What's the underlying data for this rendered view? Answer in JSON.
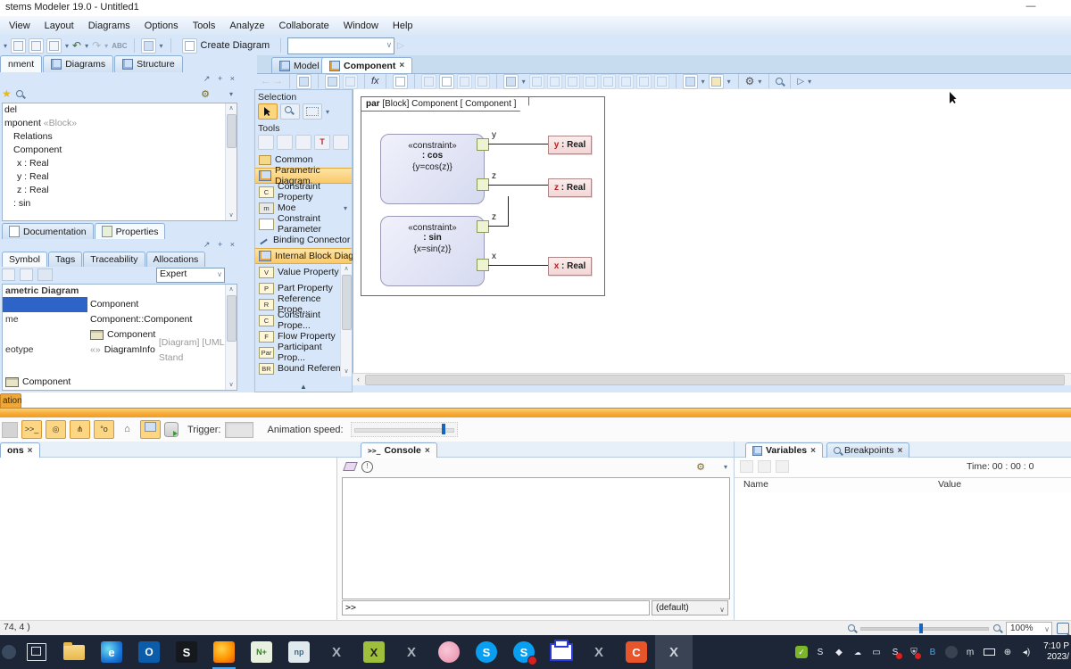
{
  "icons": {
    "minimize": "—",
    "close": "×",
    "dropdown": "▾",
    "chevron": "∨",
    "scroll_up": "∧",
    "scroll_down": "∨",
    "scroll_left": "‹",
    "palette_up": "▲",
    "float": "↗",
    "pin": "+",
    "gear": "⚙",
    "star": "★",
    "play": "▷",
    "fx": "fx",
    "abc": "ABC",
    "undo": "↶",
    "redo": "↷",
    "back": "←",
    "forward": "→",
    "console_glyph": ">>_",
    "target_glyph": "◎",
    "tree_glyph": "⋔",
    "nodes_glyph": "°o",
    "bang": "!",
    "x_letter": "X",
    "s_letter": "S",
    "o_letter": "O",
    "c_letter": "C",
    "e_letter": "e",
    "n_letters": "N+",
    "np_letters": "np",
    "diamond": "◆",
    "bt_letter": "B",
    "mic_glyph": "ṃ",
    "globe_glyph": "⊕",
    "spk_glyph": "◂)",
    "bubble_glyph": "▭",
    "check": "✓"
  },
  "title_bar": {
    "title": "stems Modeler 19.0 - Untitled1"
  },
  "menu": {
    "items": [
      {
        "label": "View"
      },
      {
        "label": "Layout"
      },
      {
        "label": "Diagrams"
      },
      {
        "label": "Options"
      },
      {
        "label": "Tools"
      },
      {
        "label": "Analyze"
      },
      {
        "label": "Collaborate"
      },
      {
        "label": "Window"
      },
      {
        "label": "Help"
      }
    ]
  },
  "main_toolbar": {
    "create_diagram": "Create Diagram"
  },
  "left_tabs": {
    "items": [
      {
        "label": "nment"
      },
      {
        "label": "Diagrams"
      },
      {
        "label": "Structure"
      }
    ]
  },
  "diagram_tabs": {
    "model": "Model",
    "component": "Component"
  },
  "containment": {
    "items": [
      {
        "label": "del",
        "stereotype": ""
      },
      {
        "label": "mponent ",
        "stereotype": "«Block»"
      },
      {
        "label": "Relations",
        "stereotype": ""
      },
      {
        "label": "Component",
        "stereotype": ""
      },
      {
        "label": "x : Real",
        "stereotype": ""
      },
      {
        "label": "y : Real",
        "stereotype": ""
      },
      {
        "label": "z : Real",
        "stereotype": ""
      },
      {
        "label": ": sin",
        "stereotype": ""
      }
    ]
  },
  "doc_tabs": {
    "documentation": "Documentation",
    "properties": "Properties"
  },
  "properties_panel": {
    "tabs": [
      {
        "label": "Symbol"
      },
      {
        "label": "Tags"
      },
      {
        "label": "Traceability"
      },
      {
        "label": "Allocations"
      }
    ],
    "mode": "Expert",
    "category": "ametric Diagram",
    "rows": [
      {
        "label": "",
        "value": "Component"
      },
      {
        "label": "me",
        "value": "Component::Component"
      },
      {
        "label": "",
        "value": "Component"
      },
      {
        "label": "eotype",
        "value_prefix": "«»",
        "value": "DiagramInfo",
        "value_suffix": "[Diagram] [UML Stand"
      }
    ],
    "footer_value": "Component"
  },
  "palette": {
    "selection_label": "Selection",
    "tools_label": "Tools",
    "tools_t": "T",
    "groups": [
      {
        "label": "Common"
      },
      {
        "label": "Parametric Diagram"
      },
      {
        "label": "Internal Block Diagram"
      }
    ],
    "items": [
      {
        "badge": "C",
        "label": "Constraint Property"
      },
      {
        "badge": "m",
        "label": "Moe"
      },
      {
        "badge": "",
        "label": "Constraint Parameter"
      },
      {
        "badge": "",
        "label": "Binding Connector"
      },
      {
        "badge": "V",
        "label": "Value Property"
      },
      {
        "badge": "P",
        "label": "Part Property"
      },
      {
        "badge": "R",
        "label": "Reference Prope..."
      },
      {
        "badge": "C",
        "label": "Constraint Prope..."
      },
      {
        "badge": "F",
        "label": "Flow Property"
      },
      {
        "badge": "Par",
        "label": "Participant Prop..."
      },
      {
        "badge": "BR",
        "label": "Bound Reference"
      }
    ]
  },
  "diagram": {
    "frame_kind": "par",
    "frame_title": "[Block] Component [ Component ]",
    "constraints": [
      {
        "stereotype": "«constraint»",
        "name": ": cos",
        "expr": "{y=cos(z)}"
      },
      {
        "stereotype": "«constraint»",
        "name": ": sin",
        "expr": "{x=sin(z)}"
      }
    ],
    "labels": [
      {
        "t": "y"
      },
      {
        "t": "z"
      },
      {
        "t": "z"
      },
      {
        "t": "x"
      }
    ],
    "values": [
      {
        "name": "y",
        "type": " : Real"
      },
      {
        "name": "z",
        "type": " : Real"
      },
      {
        "name": "x",
        "type": " : Real"
      }
    ]
  },
  "simulation": {
    "tab": "ation",
    "trigger_label": "Trigger:",
    "speed_label": "Animation speed:"
  },
  "bottom_left": {
    "tab": "ons"
  },
  "console": {
    "tab": "Console",
    "prompt": ">>",
    "scope": "(default)"
  },
  "variables": {
    "tab": "Variables",
    "breakpoints_tab": "Breakpoints",
    "time": "Time: 00 : 00 : 0",
    "columns": [
      {
        "label": "Name"
      },
      {
        "label": "Value"
      }
    ]
  },
  "status_bar": {
    "coords": "74, 4 )",
    "zoom": "100%"
  },
  "taskbar": {
    "clock_time": "7:10 P",
    "clock_date": "2023/"
  }
}
